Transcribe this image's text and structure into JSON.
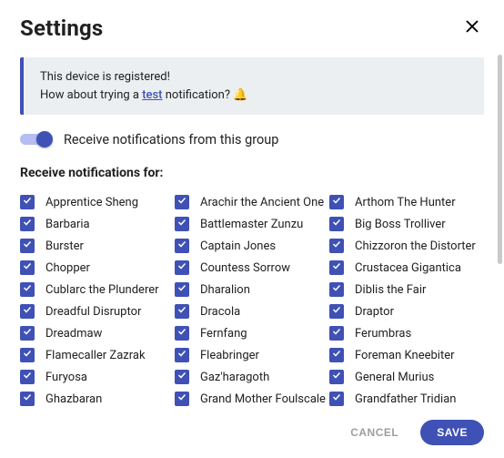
{
  "header": {
    "title": "Settings"
  },
  "banner": {
    "line1": "This device is registered!",
    "line2_prefix": "How about trying a ",
    "line2_link": "test",
    "line2_suffix": " notification? ",
    "emoji": "🔔"
  },
  "toggle": {
    "label": "Receive notifications from this group",
    "on": true
  },
  "section": {
    "label": "Receive notifications for:"
  },
  "columns": [
    [
      "Apprentice Sheng",
      "Barbaria",
      "Burster",
      "Chopper",
      "Cublarc the Plunderer",
      "Dreadful Disruptor",
      "Dreadmaw",
      "Flamecaller Zazrak",
      "Furyosa",
      "Ghazbaran"
    ],
    [
      "Arachir the Ancient One",
      "Battlemaster Zunzu",
      "Captain Jones",
      "Countess Sorrow",
      "Dharalion",
      "Dracola",
      "Fernfang",
      "Fleabringer",
      "Gaz'haragoth",
      "Grand Mother Foulscale"
    ],
    [
      "Arthom The Hunter",
      "Big Boss Trolliver",
      "Chizzoron the Distorter",
      "Crustacea Gigantica",
      "Diblis the Fair",
      "Draptor",
      "Ferumbras",
      "Foreman Kneebiter",
      "General Murius",
      "Grandfather Tridian"
    ]
  ],
  "footer": {
    "cancel": "CANCEL",
    "save": "SAVE"
  },
  "icons": {
    "close": "close-icon",
    "check": "check-icon"
  }
}
